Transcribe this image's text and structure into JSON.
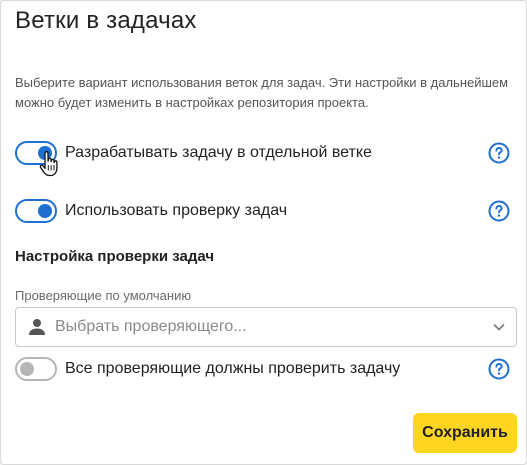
{
  "dialog": {
    "title": "Ветки в задачах",
    "description": "Выберите вариант использования веток для задач. Эти настройки в дальнейшем можно будет изменить в настройках репозитория проекта."
  },
  "options": [
    {
      "label": "Разрабатывать задачу в отдельной ветке",
      "enabled": true,
      "help_icon": "question-circle-icon"
    },
    {
      "label": "Использовать проверку задач",
      "enabled": true,
      "help_icon": "question-circle-icon"
    }
  ],
  "review_settings": {
    "section_title": "Настройка проверки задач",
    "reviewers_label": "Проверяющие по умолчанию",
    "reviewers_placeholder": "Выбрать проверяющего...",
    "reviewers_icon": "user-icon",
    "all_must_review": {
      "label": "Все проверяющие должны проверить задачу",
      "enabled": false,
      "help_icon": "question-circle-icon"
    }
  },
  "actions": {
    "save_label": "Сохранить"
  },
  "colors": {
    "accent": "#1f6fd1",
    "save_button": "#ffd61f",
    "toggle_off": "#b5b5b5"
  }
}
